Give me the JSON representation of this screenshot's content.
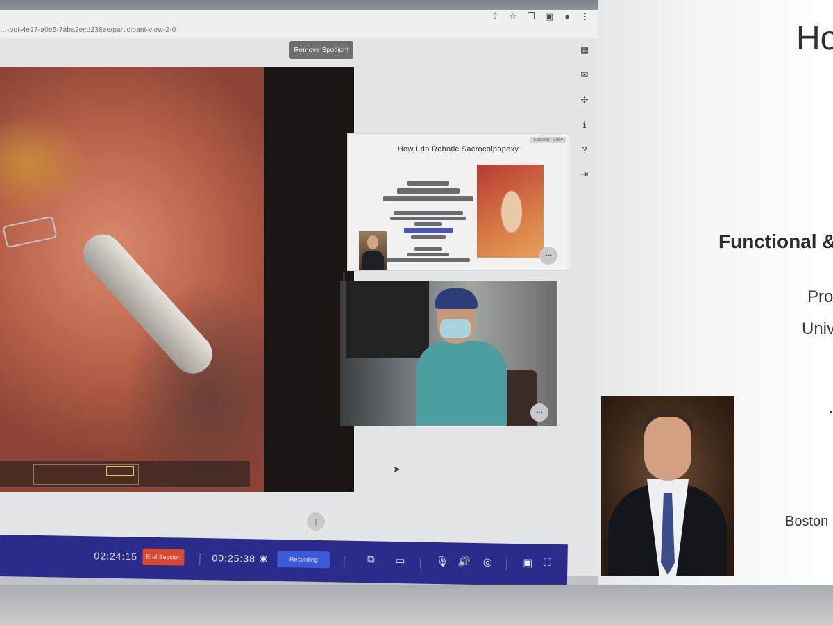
{
  "browser": {
    "url": "…-out-4e27-a0e5-7aba2ecd238ae/participant-view-2-0",
    "icons": [
      "share-icon",
      "star-icon",
      "copy-icon",
      "extension-icon",
      "profile-icon",
      "menu-icon"
    ]
  },
  "conference": {
    "remove_spotlight_label": "Remove Spotlight",
    "slide_panel": {
      "title": "How I do Robotic Sacrocolpopexy",
      "tag": "Speaker View"
    },
    "participant_badge": "•••",
    "right_toolbar_icons": [
      "layout-icon",
      "chat-icon",
      "tools-icon",
      "info-icon",
      "help-icon",
      "exit-icon"
    ]
  },
  "controls": {
    "session_time": "02:24:15",
    "end_session_label": "End Session",
    "recording_time": "00:25:38",
    "recording_label": "Recording",
    "accent_color": "#2a2b8a",
    "end_color": "#d64a35",
    "recording_color": "#3c5bd8"
  },
  "slide": {
    "heading": "Ho",
    "subheading": "Functional &",
    "line1": "Pro",
    "line2": "Univ",
    "line3": "Boston"
  }
}
